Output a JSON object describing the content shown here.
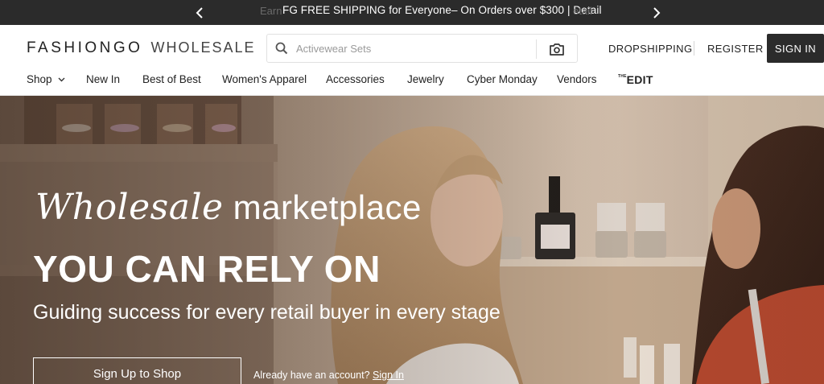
{
  "promo": {
    "ghost_left": "Earn",
    "message": "FG FREE SHIPPING for Everyone– On Orders over $300 | Detail",
    "ghost_right": "etail"
  },
  "header": {
    "brand": "FASHIONGO",
    "brand_sub": "WHOLESALE",
    "search_placeholder": "Activewear Sets",
    "dropshipping": "DROPSHIPPING",
    "register": "REGISTER",
    "signin": "SIGN IN"
  },
  "nav": {
    "items": [
      "Shop",
      "New In",
      "Best of Best",
      "Women's Apparel",
      "Accessories",
      "Jewelry",
      "Cyber Monday",
      "Vendors"
    ],
    "edit_small": "THE",
    "edit_big": "EDIT"
  },
  "hero": {
    "script_word": "Wholesale",
    "plain_word": "marketplace",
    "headline": "YOU CAN RELY ON",
    "subline": "Guiding success for every retail buyer in every stage",
    "cta": "Sign Up to Shop",
    "already_text": "Already have an account?",
    "signin_link": "Sign In"
  },
  "icons": {
    "prev": "chevron-left-icon",
    "next": "chevron-right-icon",
    "search": "search-icon",
    "camera": "camera-icon",
    "shop_dropdown": "chevron-down-icon"
  }
}
